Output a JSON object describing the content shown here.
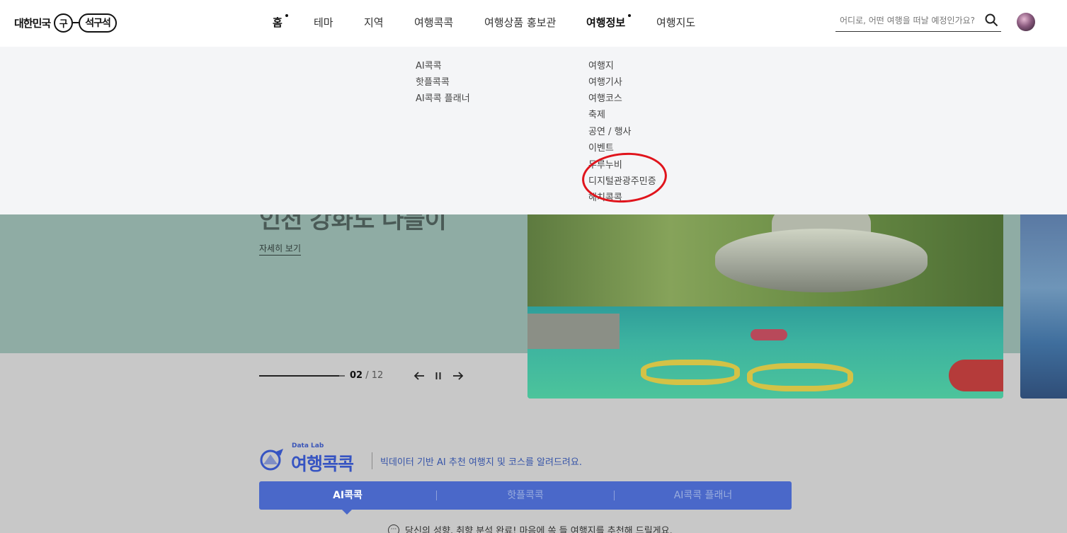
{
  "header": {
    "logo_text": "대한민국",
    "logo_circle": "구",
    "logo_pill": "석구석",
    "nav": [
      {
        "label": "홈",
        "active": true
      },
      {
        "label": "테마",
        "active": false
      },
      {
        "label": "지역",
        "active": false
      },
      {
        "label": "여행콕콕",
        "active": false
      },
      {
        "label": "여행상품 홍보관",
        "active": false
      },
      {
        "label": "여행정보",
        "active": true
      },
      {
        "label": "여행지도",
        "active": false
      }
    ],
    "search_placeholder": "어디로, 어떤 여행을 떠날 예정인가요?"
  },
  "dropdown": {
    "col_kokkok": [
      "AI콕콕",
      "핫플콕콕",
      "AI콕콕 플래너"
    ],
    "col_info": [
      "여행지",
      "여행기사",
      "여행코스",
      "축제",
      "공연 / 행사",
      "이벤트",
      "두루누비",
      "디지털관광주민증",
      "해치콕콕"
    ]
  },
  "hero": {
    "title": "인천 강화도 나들이",
    "link": "자세히 보기",
    "current": "02",
    "total": "/ 12"
  },
  "datalab": {
    "small": "Data Lab",
    "title": "여행콕콕",
    "desc": "빅데이터 기반 AI 추천 여행지 및 코스를 알려드려요.",
    "tabs": [
      "AI콕콕",
      "핫플콕콕",
      "AI콕콕 플래너"
    ],
    "notice": "당신의 성향, 취향 분석 완료! 마음에 쏙 들 여행지를 추천해 드릴게요."
  },
  "colors": {
    "accent": "#4a68c9",
    "annotation": "#e0141c"
  }
}
